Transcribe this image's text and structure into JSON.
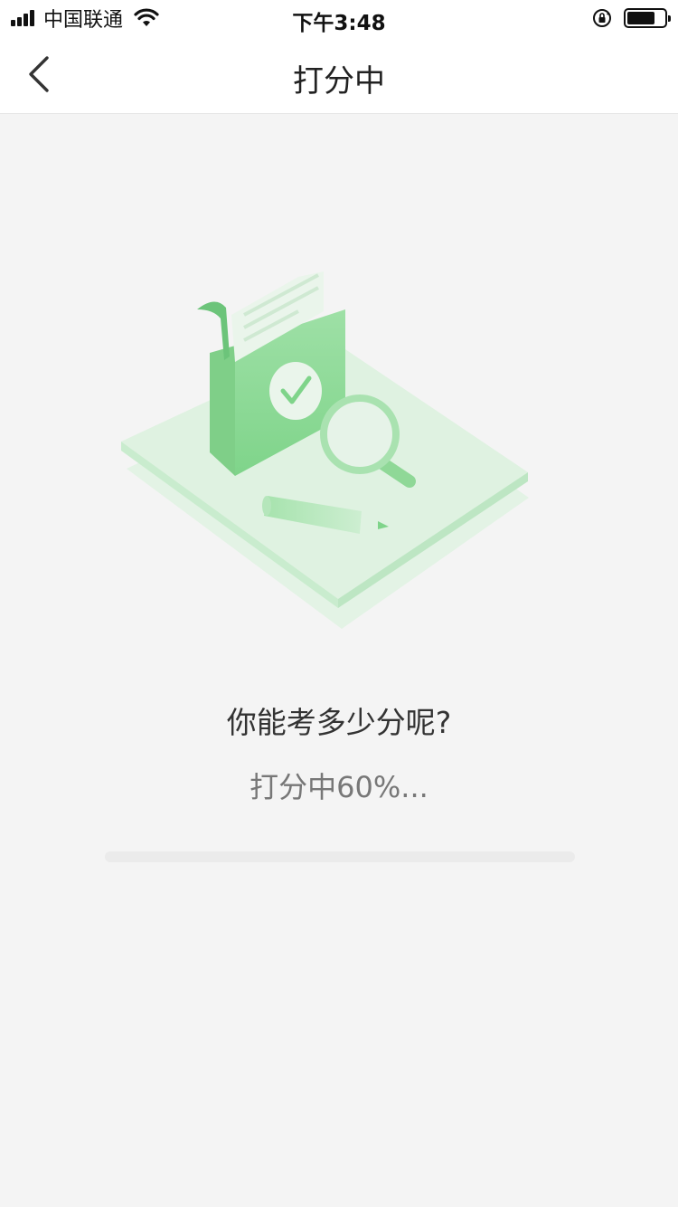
{
  "status_bar": {
    "carrier": "中国联通",
    "time": "下午3:48",
    "battery_level_percent": 75,
    "icons": [
      "signal-icon",
      "wifi-icon",
      "orientation-lock-icon",
      "battery-icon"
    ]
  },
  "nav": {
    "title": "打分中",
    "back_icon": "chevron-left-icon"
  },
  "main": {
    "question": "你能考多少分呢?",
    "progress_label": "打分中60%...",
    "progress_value": 0.6
  },
  "colors": {
    "background": "#f4f4f4",
    "accent_green": "#7fd48a",
    "light_green": "#dff2e1",
    "text_primary": "#333333",
    "text_secondary": "#777777"
  }
}
